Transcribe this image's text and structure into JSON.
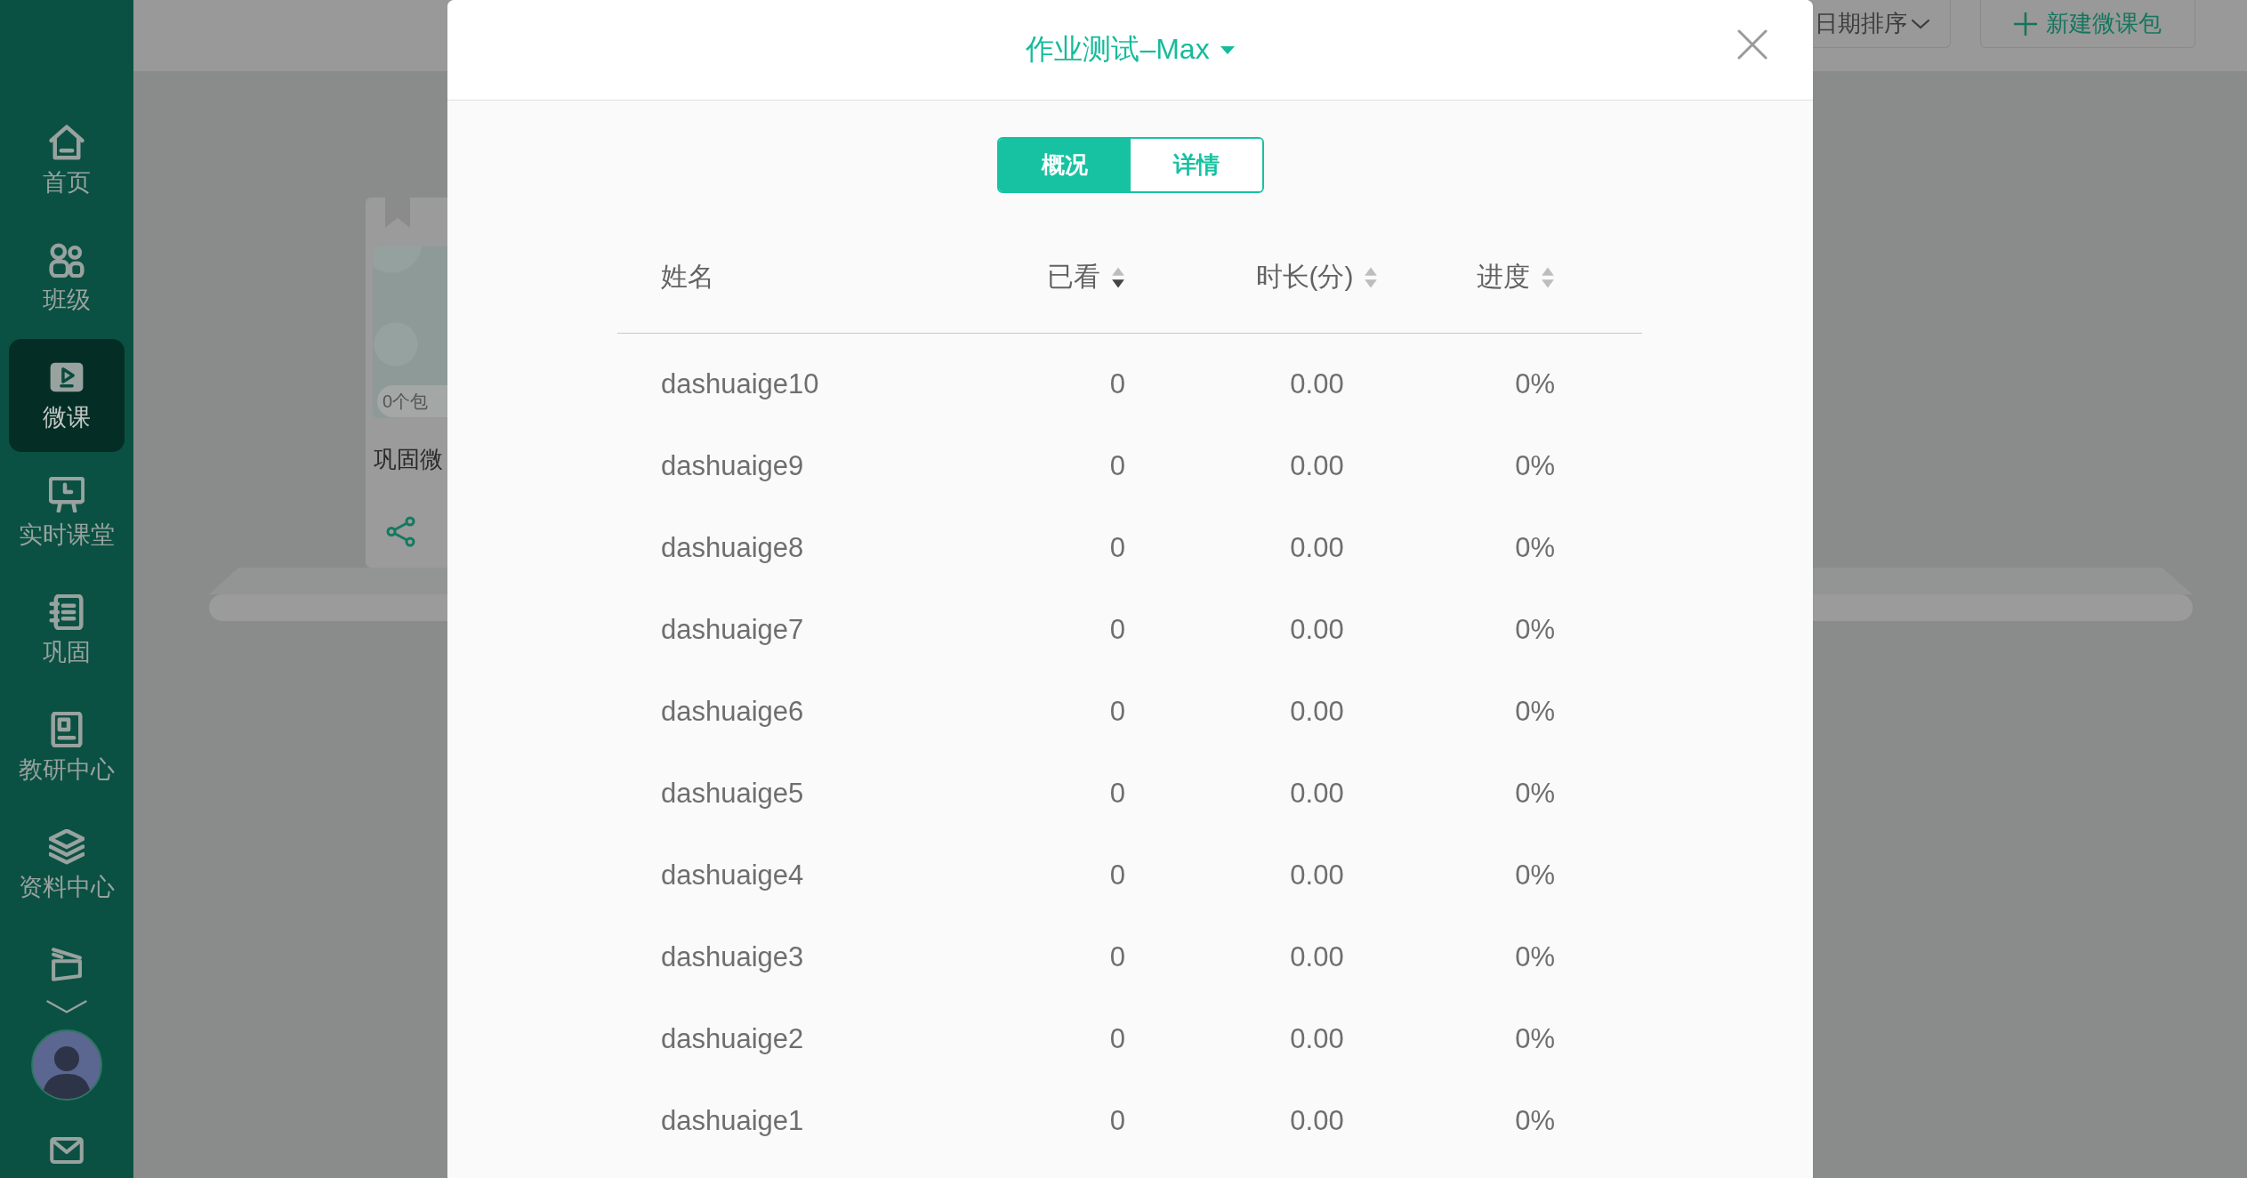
{
  "sidebar": {
    "items": [
      {
        "label": "首页",
        "selected": false
      },
      {
        "label": "班级",
        "selected": false
      },
      {
        "label": "微课",
        "selected": true
      },
      {
        "label": "实时课堂",
        "selected": false
      },
      {
        "label": "巩固",
        "selected": false
      },
      {
        "label": "教研中心",
        "selected": false
      },
      {
        "label": "资料中心",
        "selected": false
      }
    ]
  },
  "toolbar": {
    "sort_button": "日期排序",
    "new_button": "新建微课包"
  },
  "card": {
    "badge": "0个包",
    "title": "巩固微"
  },
  "dialog": {
    "title": "作业测试–Max",
    "tabs": [
      {
        "label": "概况",
        "selected": true
      },
      {
        "label": "详情",
        "selected": false
      }
    ],
    "table": {
      "columns": [
        {
          "label": "姓名",
          "sortable": false
        },
        {
          "label": "已看",
          "sortable": true,
          "sort_ascending": false,
          "sort_descending": true
        },
        {
          "label": "时长(分)",
          "sortable": true,
          "sort_ascending": false,
          "sort_descending": false
        },
        {
          "label": "进度",
          "sortable": true,
          "sort_ascending": false,
          "sort_descending": false
        }
      ],
      "rows": [
        [
          "dashuaige10",
          "0",
          "0.00",
          "0%"
        ],
        [
          "dashuaige9",
          "0",
          "0.00",
          "0%"
        ],
        [
          "dashuaige8",
          "0",
          "0.00",
          "0%"
        ],
        [
          "dashuaige7",
          "0",
          "0.00",
          "0%"
        ],
        [
          "dashuaige6",
          "0",
          "0.00",
          "0%"
        ],
        [
          "dashuaige5",
          "0",
          "0.00",
          "0%"
        ],
        [
          "dashuaige4",
          "0",
          "0.00",
          "0%"
        ],
        [
          "dashuaige3",
          "0",
          "0.00",
          "0%"
        ],
        [
          "dashuaige2",
          "0",
          "0.00",
          "0%"
        ],
        [
          "dashuaige1",
          "0",
          "0.00",
          "0%"
        ]
      ]
    }
  }
}
